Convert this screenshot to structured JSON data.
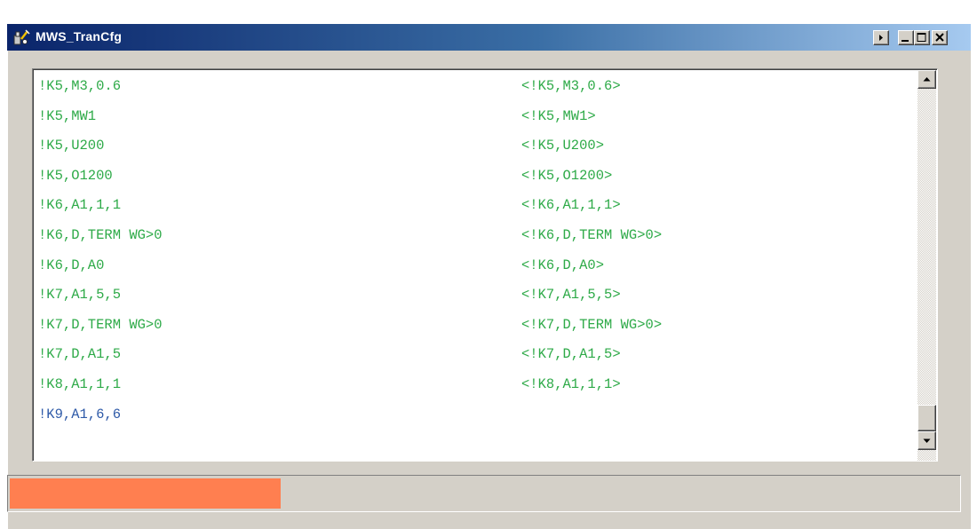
{
  "window": {
    "title": "MWS_TranCfg",
    "icon": "app-tools-icon"
  },
  "caption_buttons": [
    {
      "name": "menu-arrow-icon"
    },
    {
      "name": "minimize-icon"
    },
    {
      "name": "maximize-icon"
    },
    {
      "name": "close-icon"
    }
  ],
  "log": {
    "rows": [
      {
        "command": "!K5,M3,0.6",
        "response": "<!K5,M3,0.6>"
      },
      {
        "command": "!K5,MW1",
        "response": "<!K5,MW1>"
      },
      {
        "command": "!K5,U200",
        "response": "<!K5,U200>"
      },
      {
        "command": "!K5,O1200",
        "response": "<!K5,O1200>"
      },
      {
        "command": "!K6,A1,1,1",
        "response": "<!K6,A1,1,1>"
      },
      {
        "command": "!K6,D,TERM WG>0",
        "response": "<!K6,D,TERM WG>0>"
      },
      {
        "command": "!K6,D,A0",
        "response": "<!K6,D,A0>"
      },
      {
        "command": "!K7,A1,5,5",
        "response": "<!K7,A1,5,5>"
      },
      {
        "command": "!K7,D,TERM WG>0",
        "response": "<!K7,D,TERM WG>0>"
      },
      {
        "command": "!K7,D,A1,5",
        "response": "<!K7,D,A1,5>"
      },
      {
        "command": "!K8,A1,1,1",
        "response": "<!K8,A1,1,1>"
      },
      {
        "command": "!K9,A1,6,6",
        "response": ""
      }
    ],
    "colors": {
      "completed": "#2eaa48",
      "active": "#2e5aa8"
    }
  },
  "scrollbar": {
    "up_icon": "scroll-up-arrow-icon",
    "down_icon": "scroll-down-arrow-icon"
  },
  "progress": {
    "fraction": 0.286,
    "fill_color": "#ff7f50",
    "track_color": "#d4d0c8"
  }
}
